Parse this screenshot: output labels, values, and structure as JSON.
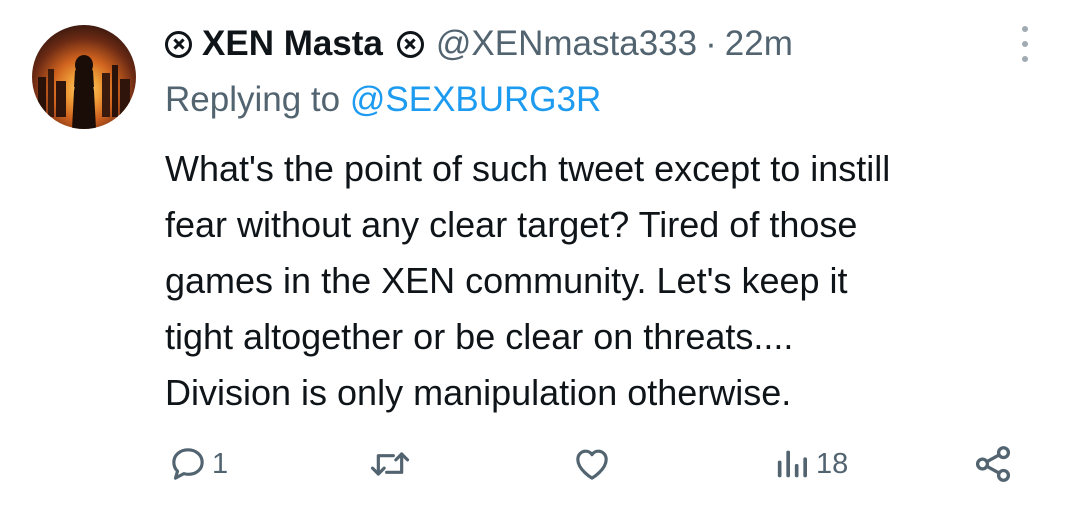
{
  "tweet": {
    "author": {
      "display_name": "XEN Masta",
      "handle": "@XENmasta333",
      "badge_icon": "x-circle-icon"
    },
    "separator": "·",
    "time": "22m",
    "replying_to": {
      "prefix": "Replying to",
      "mention": "@SEXBURG3R"
    },
    "text_lines": [
      "What's the point of such tweet except to instill",
      "fear without any clear target? Tired of those",
      "games in the XEN community. Let's keep it",
      "tight altogether or be clear on threats....",
      "Division is only manipulation otherwise."
    ],
    "actions": {
      "reply_count": "1",
      "retweet_count": "",
      "like_count": "",
      "views_count": "18"
    }
  },
  "colors": {
    "text": "#0f1419",
    "secondary": "#536471",
    "link": "#1d9bf0"
  }
}
